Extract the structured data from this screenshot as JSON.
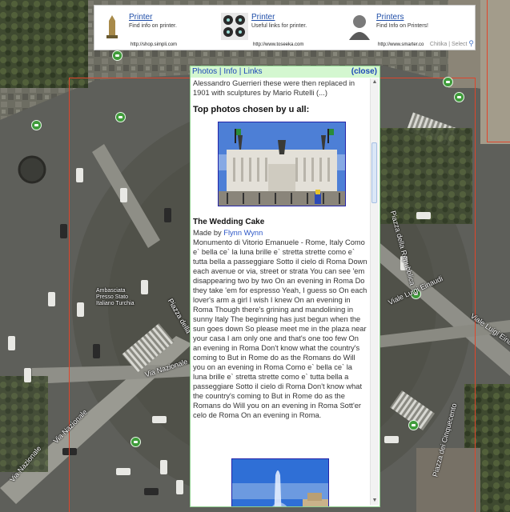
{
  "ads": [
    {
      "title": "Printer",
      "text": "Find info on printer.",
      "url": "http://shop.simpli.com",
      "thumb": "monument-thumbnail"
    },
    {
      "title": "Printer",
      "text": "Useful links for printer.",
      "url": "http://www.toseeka.com",
      "thumb": "printer-thumbnail"
    },
    {
      "title": "Printers",
      "text": "Find Info on Printers!",
      "url": "http://www.smarter.co",
      "thumb": "person-thumbnail"
    }
  ],
  "ad_footer": "Chitika | Select",
  "map": {
    "labels": {
      "via_nazionale_1": "Via Nazionale",
      "via_nazionale_2": "Via Nazionale",
      "via_nazionale_3": "Via Nazionale",
      "piazza_repubblica": "Piazza della Repubblica",
      "viale_einaudi": "Viale Luigi Einaudi",
      "viale_einaudi_2": "Viale Luigi Einaudi",
      "piazza_cinquecento": "Piazza dei Cinquecento",
      "embassy": "Ambasciata Presso Stato Italiano Turchia",
      "piazza_gallo": "Piazza della"
    }
  },
  "panel": {
    "tabs": [
      "Photos",
      "Info",
      "Links"
    ],
    "close": "(close)",
    "intro": "Alessandro Guerrieri these were then replaced in 1901 with sculptures by Mario Rutelli (...)",
    "section_title": "Top photos chosen by u all:",
    "photo_title": "The Wedding Cake",
    "made_by_prefix": "Made by",
    "author": "Flynn Wynn",
    "description": "Monumento di Vitorio Emanuele - Rome, Italy Como e` bella ce` la luna brille e` stretta strette como e` tutta bella a passeggiare Sotto il cielo di Roma Down each avenue or via, street or strata You can see 'em disappearing two by two On an evening in Roma Do they take 'em for espresso Yeah, I guess so On each lover's arm a girl I wish I knew On an evening in Roma Though there's grining and mandolining in sunny Italy The beginning has just begun when the sun goes down So please meet me in the plaza near your casa I am only one and that's one too few On an evening in Roma Don't know what the country's coming to But in Rome do as the Romans do Will you on an evening in Roma Como e` bella ce` la luna brille e` stretta strette como e` tutta bella a passeggiare Sotto il cielo di Roma Don't know what the country's coming to But in Rome do as the Romans do Will you on an evening in Roma Sott'er celo de Roma On an evening in Roma."
  },
  "colors": {
    "panel_header": "#d4f7d0",
    "link": "#1c47b8",
    "border_red": "#e0452a",
    "place_icon": "#3f9b3a"
  }
}
